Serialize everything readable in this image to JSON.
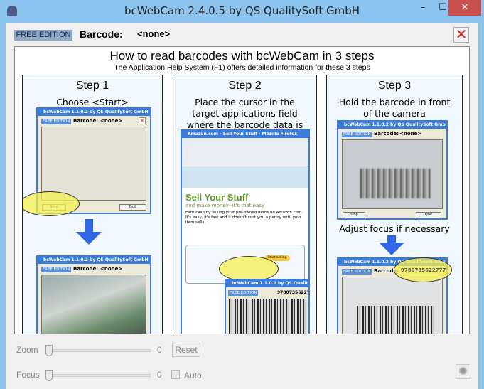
{
  "window": {
    "title": "bcWebCam 2.4.0.5 by QS QualitySoft GmbH",
    "minimize": "–",
    "maximize": "☐",
    "close": "✕"
  },
  "toolbar": {
    "edition": "FREE EDITION",
    "barcode_label": "Barcode:",
    "barcode_value": "<none>",
    "clear_icon": "✕"
  },
  "help": {
    "title": "How to read barcodes with bcWebCam in 3 steps",
    "subtitle": "The Application Help System (F1) offers detailed information for these 3 steps",
    "steps": [
      {
        "title": "Step 1",
        "desc": "Choose <Start>"
      },
      {
        "title": "Step 2",
        "desc": "Place the cursor in the target applications field where the barcode data is wanted"
      },
      {
        "title": "Step 3",
        "desc": "Hold the barcode in front of the camera",
        "desc2": "Adjust focus if necessary"
      }
    ],
    "mini": {
      "title": "bcWebCam 1.1.0.2 by QS QualitySoft GmbH",
      "edition": "FREE EDITION",
      "barcode_label": "Barcode:",
      "none": "<none>",
      "scanned": "9780735622777",
      "stop": "Stop",
      "quit": "Quit"
    },
    "browser": {
      "title": "Amazon.com - Sell Your Stuff - Mozilla Firefox",
      "heading": "Sell Your Stuff",
      "tagline": "and make money--it's that easy",
      "body": "Earn cash by selling your pre-owned items on Amazon.com. It's easy, it's fast and it doesn't cost you a penny until your item sells.",
      "button": "Start selling"
    }
  },
  "controls": {
    "zoom_label": "Zoom",
    "zoom_value": "0",
    "reset": "Reset",
    "focus_label": "Focus",
    "focus_value": "0",
    "auto": "Auto",
    "zoom_level": 0,
    "focus_level": 0
  }
}
